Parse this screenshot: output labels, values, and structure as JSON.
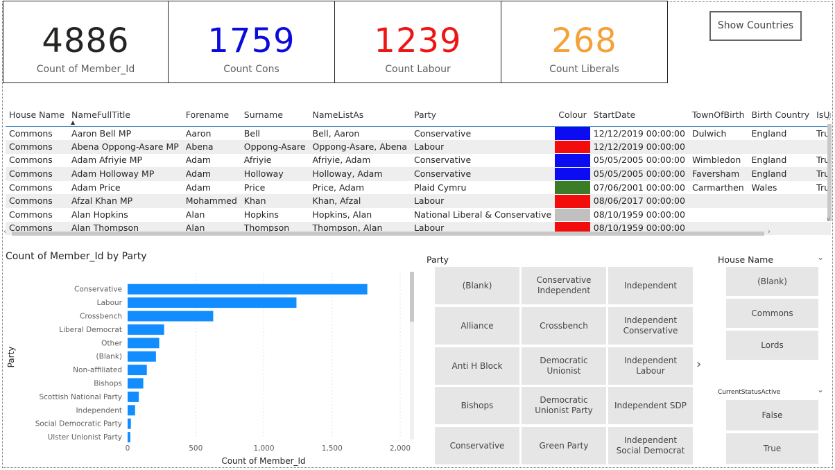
{
  "cards": [
    {
      "value": "4886",
      "label": "Count of Member_Id",
      "color": "#252423"
    },
    {
      "value": "1759",
      "label": "Count Cons",
      "color": "#0b0bdb"
    },
    {
      "value": "1239",
      "label": "Count Labour",
      "color": "#ef1515"
    },
    {
      "value": "268",
      "label": "Count Liberals",
      "color": "#f4a13a"
    }
  ],
  "show_countries_label": "Show Countries",
  "table": {
    "columns": [
      "House Name",
      "NameFullTitle",
      "Forename",
      "Surname",
      "NameListAs",
      "Party",
      "Colour",
      "StartDate",
      "TownOfBirth",
      "Birth Country",
      "IsUnit"
    ],
    "rows": [
      [
        "Commons",
        "Aaron Bell MP",
        "Aaron",
        "Bell",
        "Bell, Aaron",
        "Conservative",
        "#0c0cf2",
        "12/12/2019 00:00:00",
        "Dulwich",
        "England",
        "True"
      ],
      [
        "Commons",
        "Abena Oppong-Asare MP",
        "Abena",
        "Oppong-Asare",
        "Oppong-Asare, Abena",
        "Labour",
        "#f20c0c",
        "12/12/2019 00:00:00",
        "",
        "",
        ""
      ],
      [
        "Commons",
        "Adam Afriyie MP",
        "Adam",
        "Afriyie",
        "Afriyie, Adam",
        "Conservative",
        "#0c0cf2",
        "05/05/2005 00:00:00",
        "Wimbledon",
        "England",
        "True"
      ],
      [
        "Commons",
        "Adam Holloway MP",
        "Adam",
        "Holloway",
        "Holloway, Adam",
        "Conservative",
        "#0c0cf2",
        "05/05/2005 00:00:00",
        "Faversham",
        "England",
        "True"
      ],
      [
        "Commons",
        "Adam Price",
        "Adam",
        "Price",
        "Price, Adam",
        "Plaid Cymru",
        "#3a7d26",
        "07/06/2001 00:00:00",
        "Carmarthen",
        "Wales",
        "True"
      ],
      [
        "Commons",
        "Afzal Khan MP",
        "Mohammed",
        "Khan",
        "Khan, Afzal",
        "Labour",
        "#f20c0c",
        "08/06/2017 00:00:00",
        "",
        "",
        ""
      ],
      [
        "Commons",
        "Alan Hopkins",
        "Alan",
        "Hopkins",
        "Hopkins, Alan",
        "National Liberal & Conservative",
        "#c0c0c0",
        "08/10/1959 00:00:00",
        "",
        "",
        ""
      ],
      [
        "Commons",
        "Alan Thompson",
        "Alan",
        "Thompson",
        "Thompson, Alan",
        "Labour",
        "#f20c0c",
        "08/10/1959 00:00:00",
        "",
        "",
        ""
      ]
    ]
  },
  "chart_data": {
    "type": "bar",
    "orientation": "horizontal",
    "title": "Count of Member_Id by Party",
    "xlabel": "Count of Member_Id",
    "ylabel": "Party",
    "categories": [
      "Conservative",
      "Labour",
      "Crossbench",
      "Liberal Democrat",
      "Other",
      "(Blank)",
      "Non-affiliated",
      "Bishops",
      "Scottish National Party",
      "Independent",
      "Social Democratic Party",
      "Ulster Unionist Party"
    ],
    "values": [
      1759,
      1239,
      628,
      268,
      232,
      208,
      141,
      115,
      82,
      55,
      24,
      20
    ],
    "xlim": [
      0,
      2000
    ],
    "xticks": [
      0,
      500,
      1000,
      1500,
      2000
    ],
    "xtick_labels": [
      "0",
      "500",
      "1,000",
      "1,500",
      "2,000"
    ],
    "bar_color": "#118dff",
    "grid": true
  },
  "party_slicer": {
    "title": "Party",
    "tiles": [
      [
        "(Blank)",
        "Conservative Independent",
        "Independent"
      ],
      [
        "Alliance",
        "Crossbench",
        "Independent Conservative"
      ],
      [
        "Anti H Block",
        "Democratic Unionist",
        "Independent Labour"
      ],
      [
        "Bishops",
        "Democratic Unionist Party",
        "Independent SDP"
      ],
      [
        "Conservative",
        "Green Party",
        "Independent Social Democrat"
      ]
    ]
  },
  "house_slicer": {
    "title": "House Name",
    "options": [
      "(Blank)",
      "Commons",
      "Lords"
    ]
  },
  "status_slicer": {
    "title": "CurrentStatusActive",
    "options": [
      "False",
      "True"
    ]
  },
  "icons": {
    "chevron": "chevron-down-icon",
    "next": "chevron-right-icon",
    "sort": "sort-ascending-icon"
  }
}
